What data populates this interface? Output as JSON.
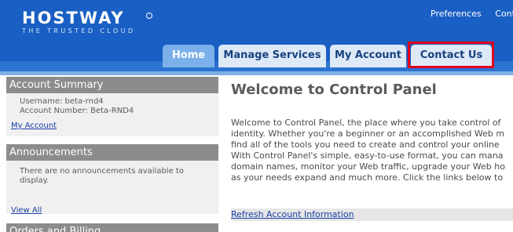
{
  "brand": {
    "name": "HOSTWAY",
    "tagline": "THE TRUSTED CLOUD"
  },
  "top_links": [
    "Preferences",
    "Cont"
  ],
  "tabs": [
    {
      "label": "Home",
      "active": true
    },
    {
      "label": "Manage Services",
      "active": false
    },
    {
      "label": "My Account",
      "active": false
    },
    {
      "label": "Contact Us",
      "active": false
    }
  ],
  "sidebar": {
    "account_summary": {
      "title": "Account Summary",
      "username": "Username: beta-rnd4",
      "account_number": "Account Number: Beta-RND4",
      "link": "My Account"
    },
    "announcements": {
      "title": "Announcements",
      "message": "There are no announcements available to display.",
      "link": "View All"
    },
    "orders": {
      "title": "Orders and Billing"
    }
  },
  "main": {
    "title": "Welcome to Control Panel",
    "intro_lines": [
      "Welcome to Control Panel, the place where you take control of",
      "identity. Whether you're a beginner or an accomplished Web m",
      "find all of the tools you need to create and control your online",
      "With Control Panel's simple, easy-to-use format, you can mana",
      "domain names, monitor your Web traffic, upgrade your Web ho",
      "as your needs expand and much more. Click the links below to"
    ],
    "refresh_link": "Refresh Account Information"
  },
  "colors": {
    "header": "#1a5fc4",
    "tab_active": "#7bb0ea",
    "highlight": "#e3001b"
  }
}
